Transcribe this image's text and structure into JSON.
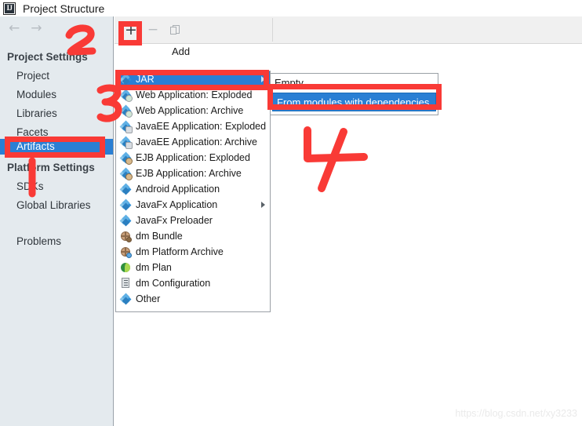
{
  "window": {
    "title": "Project Structure",
    "app_icon": "intellij-idea-icon"
  },
  "nav": {
    "back_icon": "arrow-left-icon",
    "forward_icon": "arrow-right-icon"
  },
  "sidebar": {
    "groups": [
      {
        "heading": "Project Settings",
        "items": [
          {
            "label": "Project",
            "selected": false
          },
          {
            "label": "Modules",
            "selected": false
          },
          {
            "label": "Libraries",
            "selected": false
          },
          {
            "label": "Facets",
            "selected": false
          },
          {
            "label": "Artifacts",
            "selected": true
          }
        ]
      },
      {
        "heading": "Platform Settings",
        "items": [
          {
            "label": "SDKs",
            "selected": false
          },
          {
            "label": "Global Libraries",
            "selected": false
          }
        ]
      }
    ],
    "problems": "Problems"
  },
  "toolbar": {
    "add_glyph": "+",
    "remove_glyph": "−",
    "add_icon": "plus-icon",
    "remove_icon": "minus-icon",
    "copy_icon": "copy-icon",
    "tooltip": "Add"
  },
  "menu": {
    "items": [
      {
        "label": "JAR",
        "icon": "artifact-jar-icon",
        "highlight": true,
        "submenu": true
      },
      {
        "label": "Web Application: Exploded",
        "icon": "artifact-web-exploded-icon",
        "highlight": false,
        "submenu": false
      },
      {
        "label": "Web Application: Archive",
        "icon": "artifact-web-archive-icon",
        "highlight": false,
        "submenu": false
      },
      {
        "label": "JavaEE Application: Exploded",
        "icon": "artifact-javaee-exploded-icon",
        "highlight": false,
        "submenu": false
      },
      {
        "label": "JavaEE Application: Archive",
        "icon": "artifact-javaee-archive-icon",
        "highlight": false,
        "submenu": false
      },
      {
        "label": "EJB Application: Exploded",
        "icon": "artifact-ejb-exploded-icon",
        "highlight": false,
        "submenu": false
      },
      {
        "label": "EJB Application: Archive",
        "icon": "artifact-ejb-archive-icon",
        "highlight": false,
        "submenu": false
      },
      {
        "label": "Android Application",
        "icon": "artifact-android-icon",
        "highlight": false,
        "submenu": false
      },
      {
        "label": "JavaFx Application",
        "icon": "artifact-javafx-icon",
        "highlight": false,
        "submenu": true
      },
      {
        "label": "JavaFx Preloader",
        "icon": "artifact-javafx-preloader-icon",
        "highlight": false,
        "submenu": false
      },
      {
        "label": "dm Bundle",
        "icon": "dm-bundle-icon",
        "highlight": false,
        "submenu": false
      },
      {
        "label": "dm Platform Archive",
        "icon": "dm-platform-archive-icon",
        "highlight": false,
        "submenu": false
      },
      {
        "label": "dm Plan",
        "icon": "dm-plan-icon",
        "highlight": false,
        "submenu": false
      },
      {
        "label": "dm Configuration",
        "icon": "dm-configuration-icon",
        "highlight": false,
        "submenu": false
      },
      {
        "label": "Other",
        "icon": "artifact-other-icon",
        "highlight": false,
        "submenu": false
      }
    ]
  },
  "submenu": {
    "items": [
      {
        "label": "Empty",
        "highlight": false
      },
      {
        "label": "From modules with dependencies...",
        "highlight": true
      }
    ]
  },
  "annotations": {
    "color": "#f93a36",
    "marks": [
      {
        "name": "step-2-numeral",
        "text": "2"
      },
      {
        "name": "step-3-numeral",
        "text": "3"
      },
      {
        "name": "step-4-numeral",
        "text": "4"
      },
      {
        "name": "artifacts-highlight-box",
        "text": ""
      },
      {
        "name": "plus-button-highlight-box",
        "text": ""
      },
      {
        "name": "jar-item-highlight-box",
        "text": ""
      },
      {
        "name": "from-modules-highlight-box",
        "text": ""
      },
      {
        "name": "artifacts-pointer-line",
        "text": ""
      }
    ]
  },
  "watermark": {
    "text": "https://blog.csdn.net/xy3233"
  }
}
